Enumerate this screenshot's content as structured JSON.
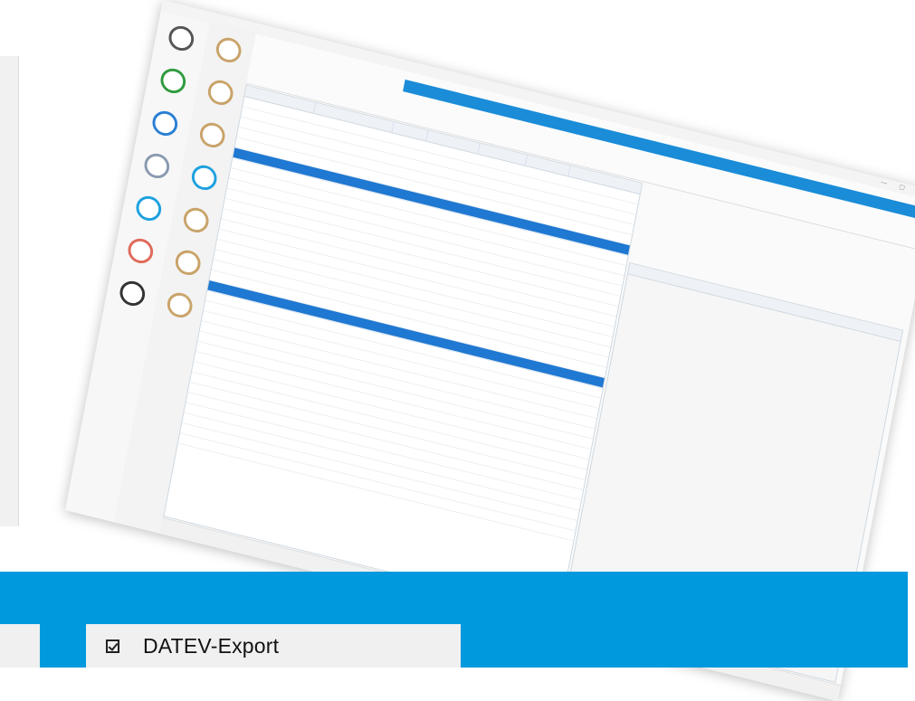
{
  "feature": {
    "label": "DATEV-Export",
    "checked": true
  },
  "colors": {
    "band": "#0099dd",
    "card": "#f0f0f0",
    "selection": "#1f78d1",
    "app_bar": "#1a8cd8"
  },
  "icons": {
    "feature_check": "checkbox-checked-icon"
  }
}
